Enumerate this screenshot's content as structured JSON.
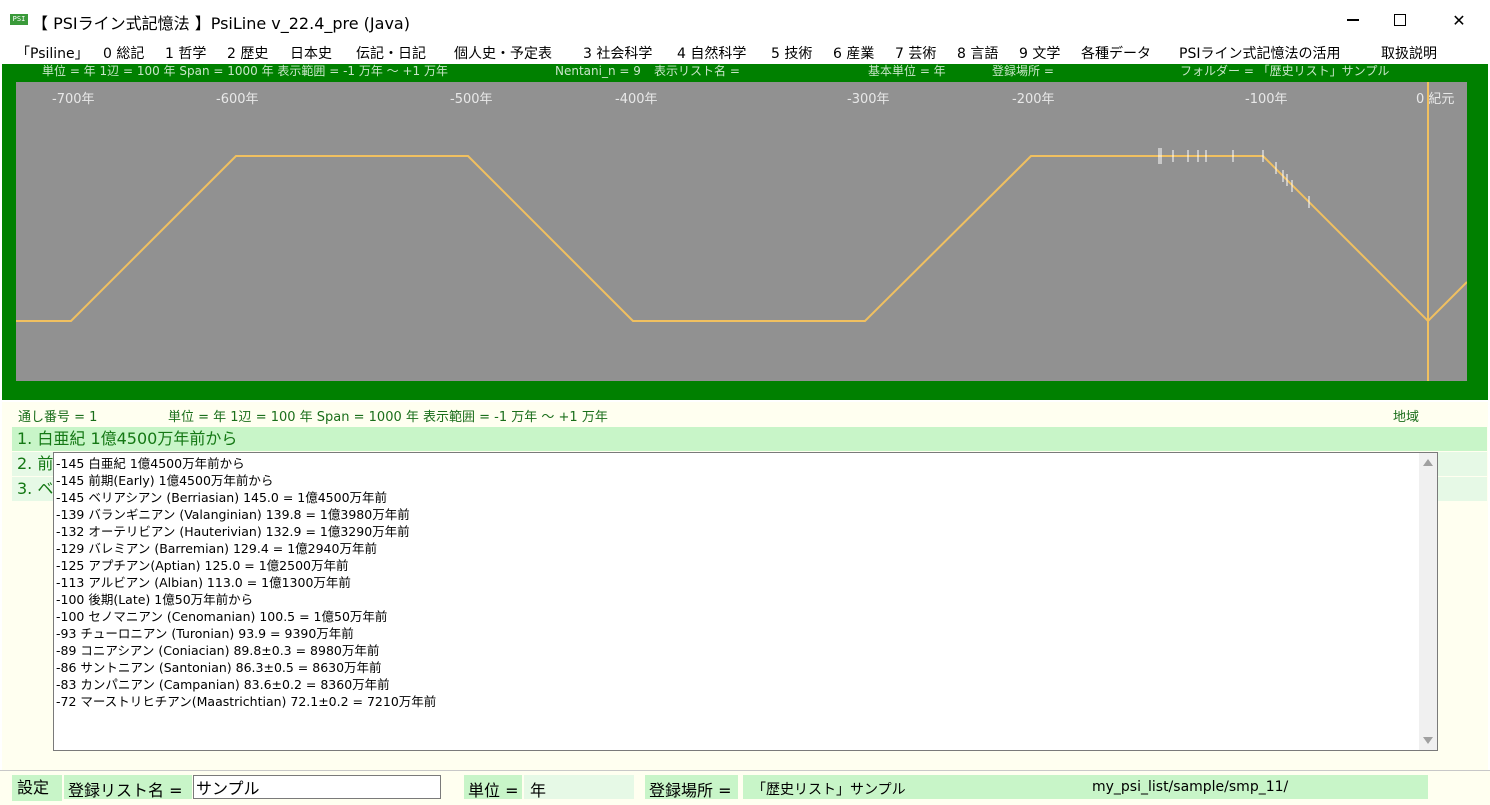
{
  "window": {
    "icon_text": "PSI",
    "title": "【 PSIライン式記憶法 】PsiLine v_22.4_pre (Java)"
  },
  "menu": [
    "「Psiline」",
    "0 総記",
    "1 哲学",
    "2 歴史",
    "日本史",
    "伝記・日記",
    "個人史・予定表",
    "3 社会科学",
    "4 自然科学",
    "5 技術",
    "6 産業",
    "7 芸術",
    "8 言語",
    "9 文学",
    "各種データ",
    "PSIライン式記憶法の活用",
    "取扱説明"
  ],
  "info_bar": {
    "unit_span": "単位 = 年  1辺 = 100 年  Span = 1000 年  表示範囲 = -1 万年 〜 +1 万年",
    "nentani": "Nentani_n = 9",
    "display_list": "表示リスト名 =",
    "base_unit": "基本単位 = 年",
    "register_place": "登録場所 =",
    "folder": "フォルダー = 「歴史リスト」サンプル"
  },
  "chart": {
    "axis_ticks": [
      "-700年",
      "-600年",
      "-500年",
      "-400年",
      "-300年",
      "-200年",
      "-100年",
      "0 紀元"
    ],
    "line_color": "#f0c060",
    "background": "#919191"
  },
  "status": {
    "serial": "通し番号 = 1",
    "unit_span": "単位 = 年  1辺 = 100 年  Span = 1000 年  表示範囲 = -1 万年 〜 +1 万年",
    "region": "地域"
  },
  "entries": [
    "1. 白亜紀 1億4500万年前から",
    "2. 前",
    "3. ベ"
  ],
  "list_items": [
    "-145  白亜紀 1億4500万年前から",
    "-145  前期(Early) 1億4500万年前から",
    "-145  ベリアシアン (Berriasian) 145.0 = 1億4500万年前",
    "-139  バランギニアン (Valanginian) 139.8 = 1億3980万年前",
    "-132  オーテリビアン (Hauterivian) 132.9 = 1億3290万年前",
    "-129  バレミアン (Barremian) 129.4 = 1億2940万年前",
    "-125  アプチアン(Aptian) 125.0 = 1億2500万年前",
    "-113  アルビアン (Albian) 113.0 = 1億1300万年前",
    "-100  後期(Late) 1億50万年前から",
    "-100  セノマニアン (Cenomanian) 100.5 = 1億50万年前",
    "-93  チューロニアン (Turonian) 93.9 = 9390万年前",
    "-89  コニアシアン (Coniacian) 89.8±0.3 = 8980万年前",
    "-86  サントニアン (Santonian) 86.3±0.5 = 8630万年前",
    "-83  カンパニアン (Campanian) 83.6±0.2 = 8360万年前",
    "-72  マーストリヒチアン(Maastrichtian) 72.1±0.2 = 7210万年前"
  ],
  "bottom": {
    "settings": "設定",
    "list_name_label": "登録リスト名 =",
    "list_name_value": "サンプル",
    "unit_label": "単位 =",
    "unit_value": "年",
    "place_label": "登録場所 =",
    "place_value": "「歴史リスト」サンプル",
    "path": "my_psi_list/sample/smp_11/"
  }
}
